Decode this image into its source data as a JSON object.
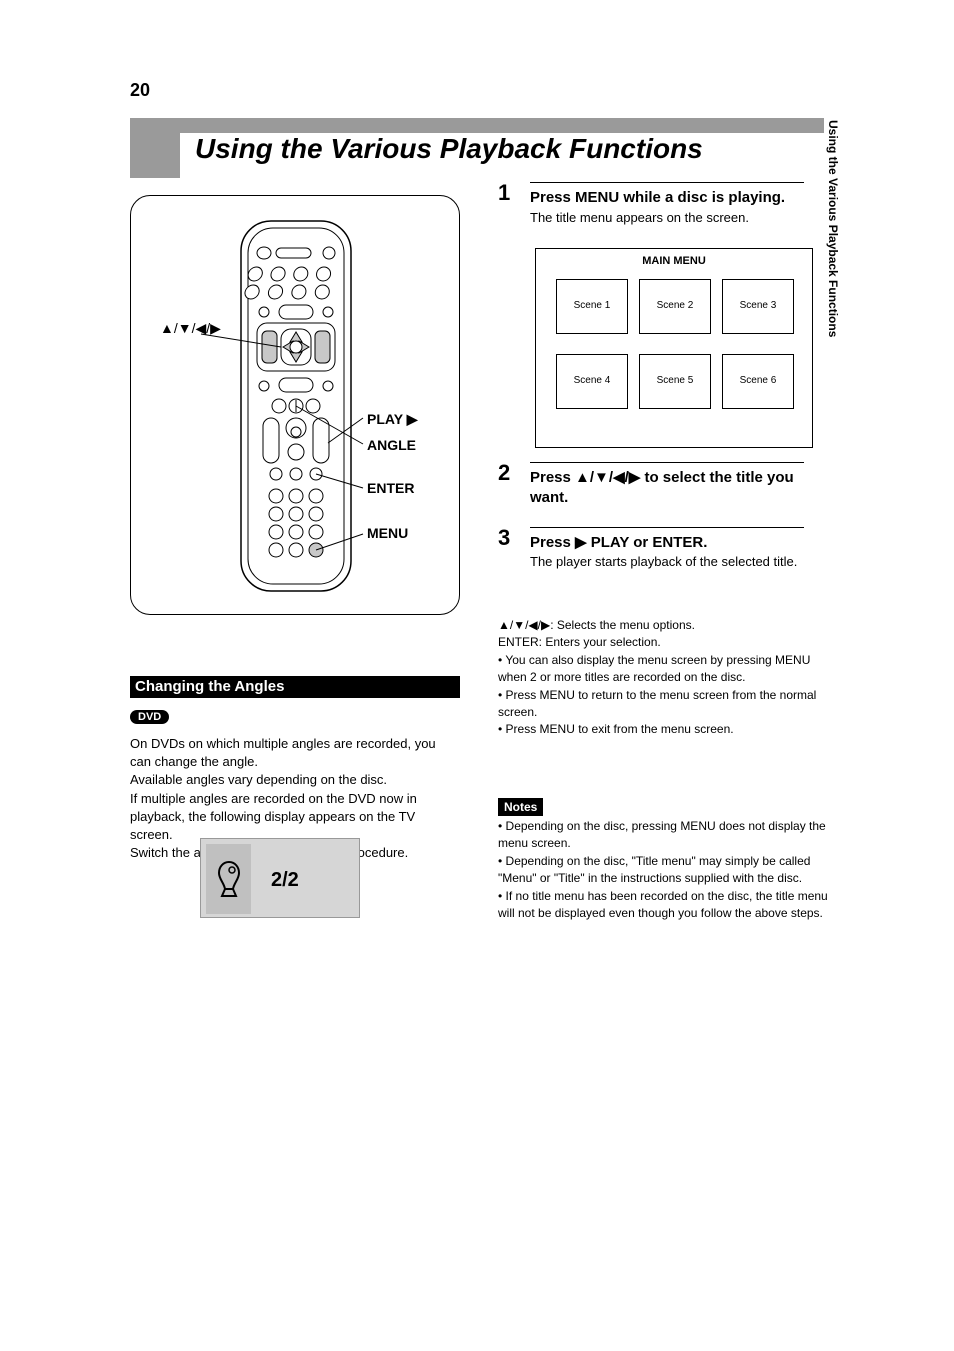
{
  "page_number_top": "20",
  "title": "Using the Various Playback Functions",
  "remote_labels": {
    "arrows": "▲/▼/◀/▶",
    "play": "PLAY ▶",
    "angle": "ANGLE",
    "enter": "ENTER",
    "menu": "MENU"
  },
  "section": {
    "header": "Changing the Angles",
    "dvd_badge": "DVD",
    "intro": "On DVDs on which multiple angles are recorded, you can change the angle.\nAvailable angles vary depending on the disc.\nIf multiple angles are recorded on the DVD now in playback, the following display appears on the TV screen.\nSwitch the angles using the following procedure."
  },
  "angle_display": {
    "value": "2/2"
  },
  "steps": {
    "s1": {
      "num": "1",
      "title": "Press MENU while a disc is playing.",
      "sub": "The title menu appears on the screen."
    },
    "s2": {
      "num": "2",
      "title": "Press ▲/▼/◀/▶ to select the title you want."
    },
    "s3": {
      "num": "3",
      "title": "Press ▶ PLAY or ENTER.",
      "body": "The player starts playback of the selected title."
    }
  },
  "menu_preview": {
    "heading": "MAIN MENU",
    "cells": [
      "Scene 1",
      "Scene 2",
      "Scene 3",
      "Scene 4",
      "Scene 5",
      "Scene 6"
    ]
  },
  "hints": "▲/▼/◀/▶: Selects the menu options.\nENTER: Enters your selection.\n• You can also display the menu screen by pressing MENU when 2 or more titles are recorded on the disc.\n• Press MENU to return to the menu screen from the normal screen.\n• Press MENU to exit from the menu screen.",
  "notes_label": "Notes",
  "notes": "• Depending on the disc, pressing MENU does not display the menu screen.\n• Depending on the disc, \"Title menu\" may simply be called \"Menu\" or \"Title\" in the instructions supplied with the disc.\n• If no title menu has been recorded on the disc, the title menu will not be displayed even though you follow the above steps.",
  "side_tab": "Using the Various Playback Functions"
}
